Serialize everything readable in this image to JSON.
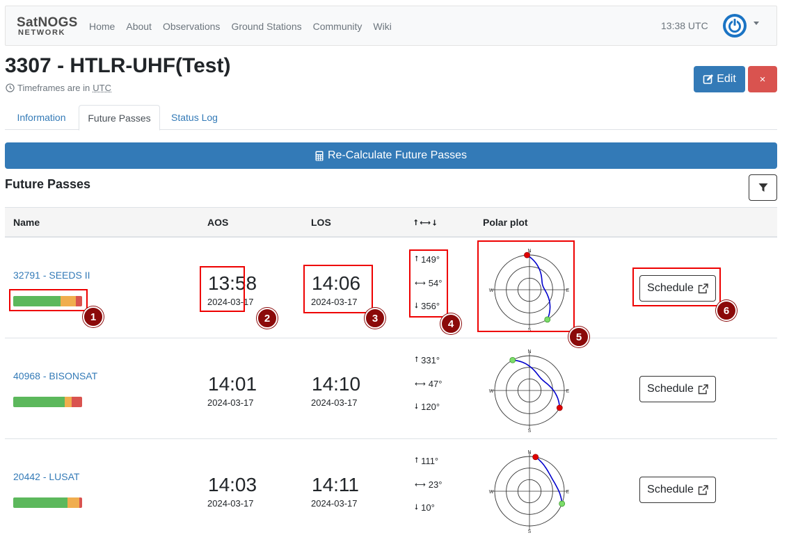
{
  "navbar": {
    "brand_line1": "SatNOGS",
    "brand_line2": "NETWORK",
    "links": [
      "Home",
      "About",
      "Observations",
      "Ground Stations",
      "Community",
      "Wiki"
    ],
    "utc_time": "13:38 UTC"
  },
  "header": {
    "title": "3307 - HTLR-UHF(Test)",
    "tz_prefix": "Timeframes are in",
    "tz_value": "UTC",
    "edit_label": "Edit",
    "close_label": "×"
  },
  "tabs": [
    "Information",
    "Future Passes",
    "Status Log"
  ],
  "recalc_label": "Re-Calculate Future Passes",
  "section_title": "Future Passes",
  "table": {
    "headers": {
      "name": "Name",
      "aos": "AOS",
      "los": "LOS",
      "polar": "Polar plot"
    },
    "rows": [
      {
        "name": "32791 - SEEDS II",
        "quality": [
          0.69,
          0.22,
          0.09
        ],
        "aos_time": "13:58",
        "aos_date": "2024-03-17",
        "los_time": "14:06",
        "los_date": "2024-03-17",
        "rise_az": "149°",
        "max_alt": "54°",
        "set_az": "356°",
        "schedule_label": "Schedule"
      },
      {
        "name": "40968 - BISONSAT",
        "quality": [
          0.75,
          0.1,
          0.15
        ],
        "aos_time": "14:01",
        "aos_date": "2024-03-17",
        "los_time": "14:10",
        "los_date": "2024-03-17",
        "rise_az": "331°",
        "max_alt": "47°",
        "set_az": "120°",
        "schedule_label": "Schedule"
      },
      {
        "name": "20442 - LUSAT",
        "quality": [
          0.79,
          0.17,
          0.04
        ],
        "aos_time": "14:03",
        "aos_date": "2024-03-17",
        "los_time": "14:11",
        "los_date": "2024-03-17",
        "rise_az": "111°",
        "max_alt": "23°",
        "set_az": "10°",
        "schedule_label": "Schedule"
      }
    ]
  },
  "polar_labels": {
    "n": "N",
    "e": "E",
    "s": "S",
    "w": "W"
  },
  "annotations": [
    "1",
    "2",
    "3",
    "4",
    "5",
    "6"
  ],
  "colors": {
    "primary": "#337ab7",
    "danger": "#d9534f",
    "success": "#5cb85c",
    "warning": "#f0ad4e",
    "annotation": "#ee0000"
  }
}
